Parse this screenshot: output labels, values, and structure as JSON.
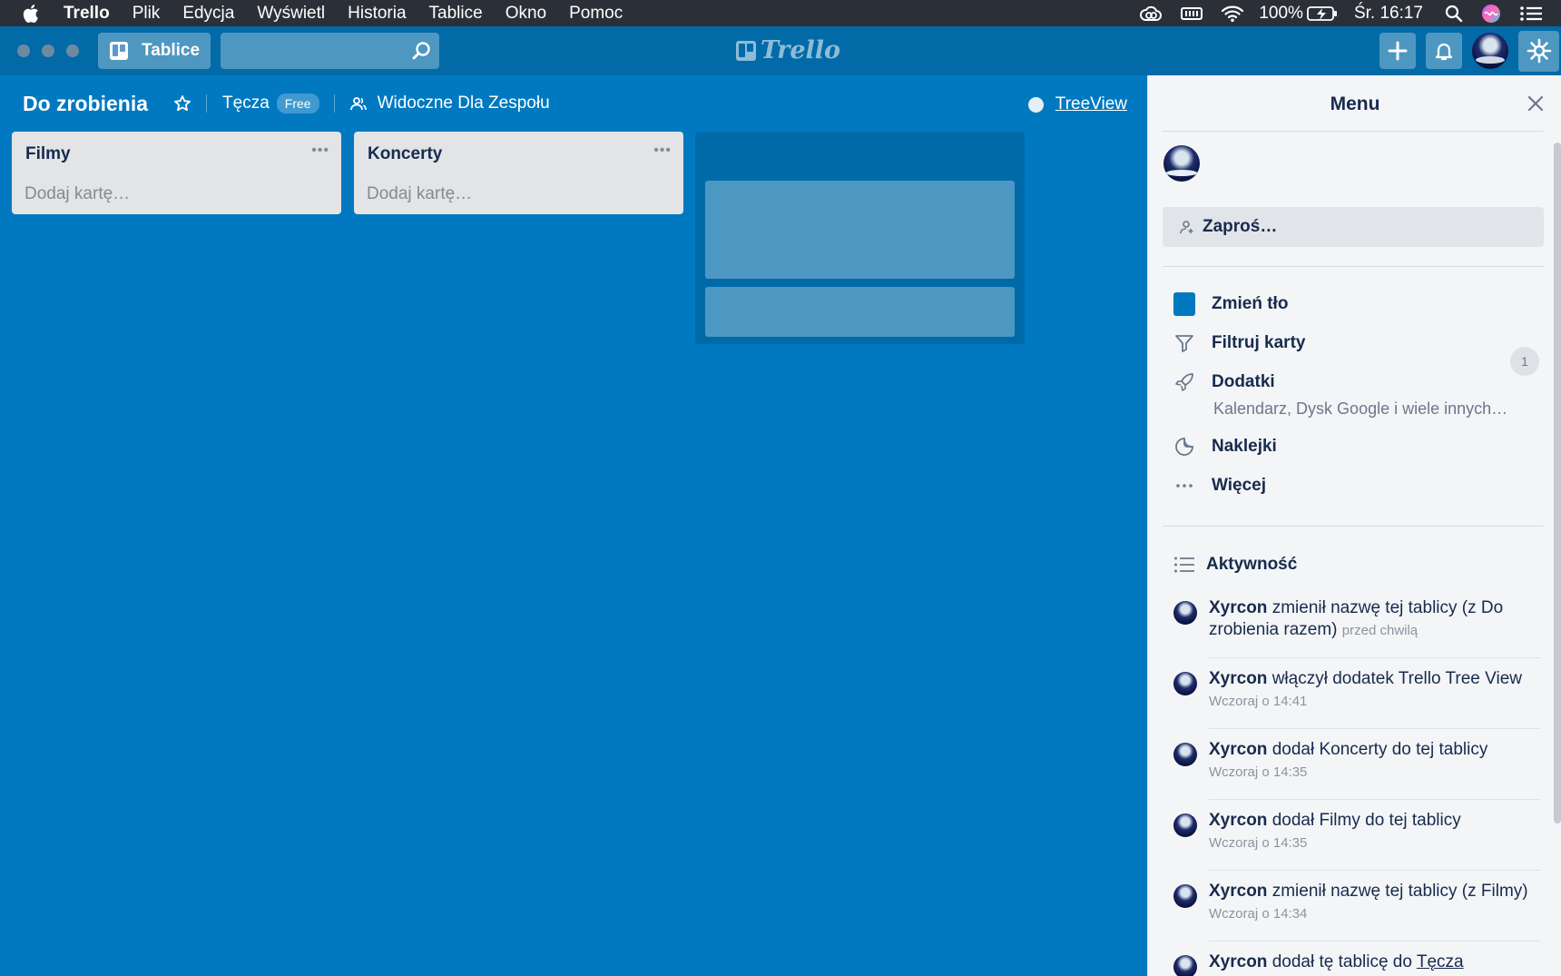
{
  "menubar": {
    "app": "Trello",
    "items": [
      "Plik",
      "Edycja",
      "Wyświetl",
      "Historia",
      "Tablice",
      "Okno",
      "Pomoc"
    ],
    "battery": "100%",
    "clock": "Śr. 16:17"
  },
  "topbar": {
    "boards_label": "Tablice",
    "search_placeholder": "",
    "logo_text": "Trello"
  },
  "board": {
    "title": "Do zrobienia",
    "team": "Tęcza",
    "team_badge": "Free",
    "visibility": "Widoczne Dla Zespołu",
    "powerup_link": "TreeView"
  },
  "lists": [
    {
      "name": "Filmy",
      "add_card": "Dodaj kartę…"
    },
    {
      "name": "Koncerty",
      "add_card": "Dodaj kartę…"
    }
  ],
  "menu": {
    "title": "Menu",
    "invite": "Zaproś…",
    "items": {
      "change_bg": "Zmień tło",
      "filter": "Filtruj karty",
      "addons": "Dodatki",
      "addons_sub": "Kalendarz, Dysk Google i wiele innych…",
      "addons_count": "1",
      "stickers": "Naklejki",
      "more": "Więcej"
    },
    "activity_title": "Aktywność",
    "activity": [
      {
        "who": "Xyrcon",
        "text": " zmienił nazwę tej tablicy (z Do zrobienia razem) ",
        "when": "przed chwilą"
      },
      {
        "who": "Xyrcon",
        "text": " włączył dodatek Trello Tree View",
        "when": "Wczoraj o 14:41"
      },
      {
        "who": "Xyrcon",
        "text": " dodał Koncerty do tej tablicy",
        "when": "Wczoraj o 14:35"
      },
      {
        "who": "Xyrcon",
        "text": " dodał Filmy do tej tablicy",
        "when": "Wczoraj o 14:35"
      },
      {
        "who": "Xyrcon",
        "text": " zmienił nazwę tej tablicy (z Filmy) ",
        "when": "Wczoraj o 14:34"
      },
      {
        "who": "Xyrcon",
        "text": " dodał tę tablicę do ",
        "link": "Tęcza"
      }
    ]
  },
  "colors": {
    "board_bg": "#0079c1",
    "header_bg": "#026aa7",
    "menubar_bg": "#2b3038",
    "menu_bg": "#f4f5f7"
  }
}
